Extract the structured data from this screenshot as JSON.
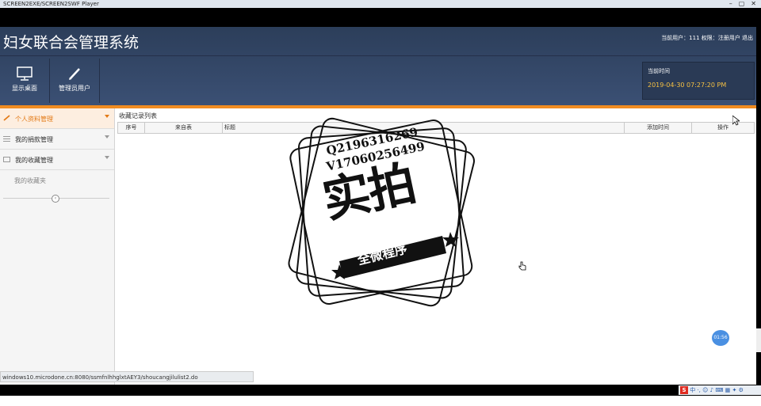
{
  "player": {
    "title": "SCREEN2EXE/SCREEN2SWF Player",
    "controls": [
      "–",
      "▢",
      "✕"
    ]
  },
  "header": {
    "title": "妇女联合会管理系统",
    "user_info": "当前用户：111 权限：注册用户 退出"
  },
  "toolbar": [
    {
      "label": "显示桌面",
      "icon": "monitor-icon"
    },
    {
      "label": "管理员用户",
      "icon": "pencil-icon"
    }
  ],
  "time_box": {
    "label": "当前时间",
    "value": "2019-04-30 07:27:20 PM"
  },
  "sidebar": {
    "items": [
      {
        "label": "个人资料管理",
        "icon": "pencil-icon"
      },
      {
        "label": "我的捐款管理",
        "icon": "list-icon"
      },
      {
        "label": "我的收藏管理",
        "icon": "folder-icon"
      }
    ],
    "sub_item": "我的收藏夹",
    "collapse_icon": "‹"
  },
  "content": {
    "list_title": "收藏记录列表",
    "columns": [
      "序号",
      "来自表",
      "标题",
      "添加时间",
      "操作"
    ]
  },
  "overlay": {
    "qq": "Q2196316269",
    "v": "V17060256499",
    "big": "实拍",
    "ribbon": "全微程序"
  },
  "status_url": "windows10.microdone.cn:8080/ssmfnlhhglxtAEY3/shoucangjilulist2.do",
  "timer_badge": "01:56",
  "tray": {
    "s_icon": "S",
    "text": "中 ·, ☺ ♪ ⌨ ▦ ✦ ⚙"
  },
  "colors": {
    "header_bg": "#33476a",
    "accent": "#f08c21",
    "time_value": "#f5c043",
    "badge": "#4a90e2"
  }
}
